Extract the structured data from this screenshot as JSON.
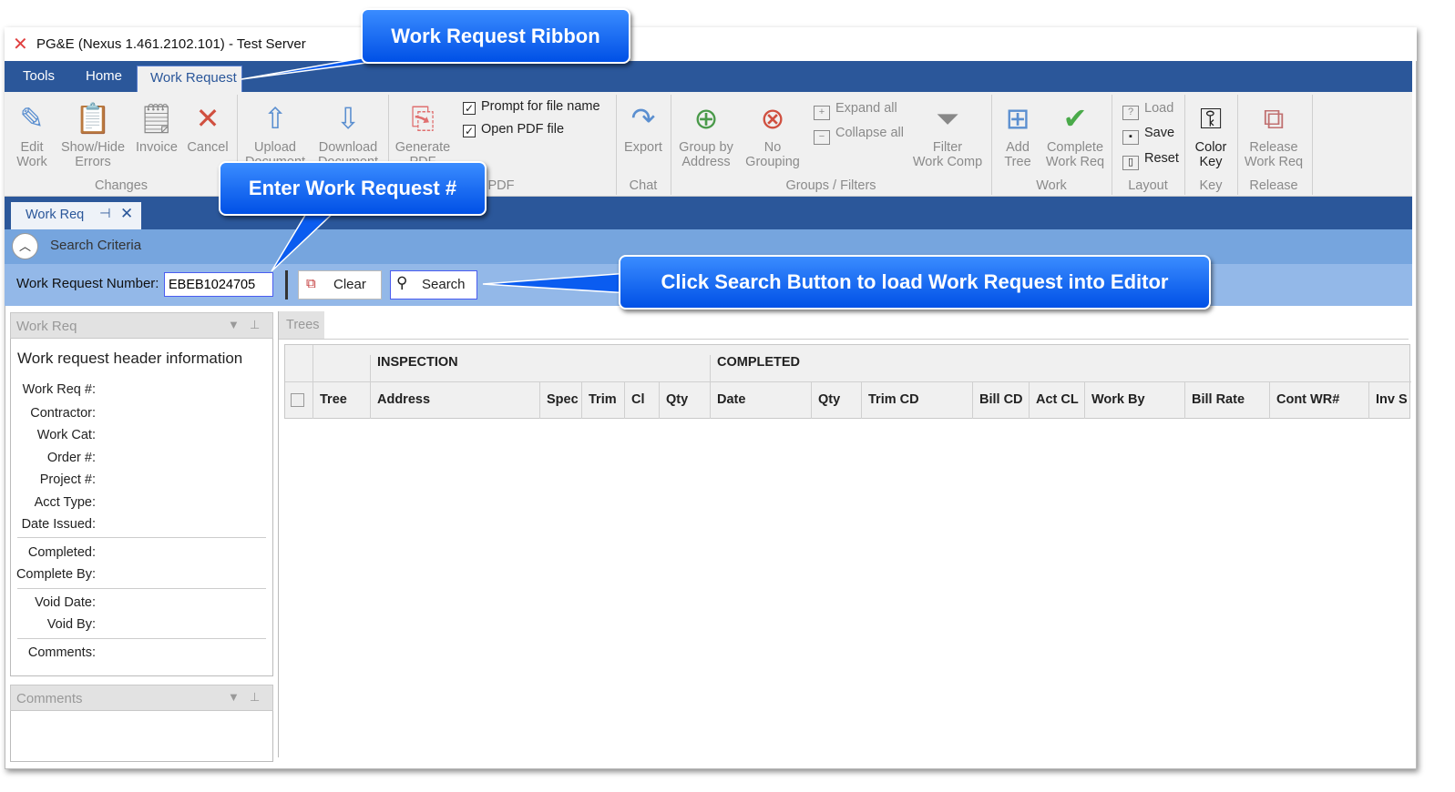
{
  "window": {
    "title": "PG&E (Nexus 1.461.2102.101) - Test Server"
  },
  "menu_tabs": [
    {
      "label": "Tools"
    },
    {
      "label": "Home"
    },
    {
      "label": "Work Request",
      "active": true
    }
  ],
  "ribbon": {
    "buttons": [
      {
        "label": [
          "Edit",
          "Work"
        ],
        "icon": "pencil-icon",
        "glyph": "✎",
        "color": "#5b8fd0",
        "enabled": false
      },
      {
        "label": [
          "Show/Hide",
          "Errors"
        ],
        "icon": "clipboard-error-icon",
        "glyph": "📋",
        "color": "#d08040",
        "enabled": false
      },
      {
        "label": [
          "Invoice",
          ""
        ],
        "icon": "document-list-icon",
        "glyph": "🗒",
        "color": "#888",
        "enabled": false
      },
      {
        "label": [
          "Cancel",
          ""
        ],
        "icon": "x-icon",
        "glyph": "✕",
        "color": "#d05040",
        "enabled": false
      },
      {
        "label": [
          "Upload",
          "Document"
        ],
        "icon": "upload-document-icon",
        "glyph": "⇧",
        "color": "#5b8fd0",
        "enabled": false
      },
      {
        "label": [
          "Download",
          "Document"
        ],
        "icon": "download-document-icon",
        "glyph": "⇩",
        "color": "#5b8fd0",
        "enabled": false
      },
      {
        "label": [
          "Generate",
          "PDF"
        ],
        "icon": "pdf-icon",
        "glyph": "⎘",
        "color": "#e07070",
        "enabled": false
      },
      {
        "label": [
          "Export",
          ""
        ],
        "icon": "export-icon",
        "glyph": "↷",
        "color": "#5b8fd0",
        "enabled": false
      },
      {
        "label": [
          "Group by",
          "Address"
        ],
        "icon": "group-add-icon",
        "glyph": "⊕",
        "color": "#4a9a4a",
        "enabled": false
      },
      {
        "label": [
          "No",
          "Grouping"
        ],
        "icon": "group-remove-icon",
        "glyph": "⊗",
        "color": "#d05040",
        "enabled": false
      },
      {
        "label": [
          "Filter",
          "Work Comp"
        ],
        "icon": "filter-icon",
        "glyph": "⏷",
        "color": "#888",
        "enabled": false
      },
      {
        "label": [
          "Add",
          "Tree"
        ],
        "icon": "add-tree-icon",
        "glyph": "⊞",
        "color": "#5b8fd0",
        "enabled": false
      },
      {
        "label": [
          "Complete",
          "Work Req"
        ],
        "icon": "clipboard-check-icon",
        "glyph": "✔",
        "color": "#4aaa4a",
        "enabled": false
      },
      {
        "label": [
          "Color",
          "Key"
        ],
        "icon": "key-icon",
        "glyph": "⚿",
        "color": "#222",
        "enabled": true
      },
      {
        "label": [
          "Release",
          "Work Req"
        ],
        "icon": "release-icon",
        "glyph": "⧉",
        "color": "#c07070",
        "enabled": false
      }
    ],
    "small_buttons": [
      {
        "label": "Expand all",
        "icon": "expand-icon",
        "glyph": "+",
        "enabled": false
      },
      {
        "label": "Collapse all",
        "icon": "collapse-icon",
        "glyph": "−",
        "enabled": false
      },
      {
        "label": "Load",
        "icon": "load-layout-icon",
        "glyph": "?",
        "enabled": false
      },
      {
        "label": "Save",
        "icon": "save-layout-icon",
        "glyph": "▪",
        "enabled": true
      },
      {
        "label": "Reset",
        "icon": "reset-layout-icon",
        "glyph": "▯",
        "enabled": true
      }
    ],
    "checkboxes": [
      {
        "label": "Prompt for file name",
        "checked": true
      },
      {
        "label": "Open PDF file",
        "checked": true
      }
    ],
    "groups": [
      "Changes",
      "PDF",
      "Chat",
      "Groups / Filters",
      "Work",
      "Layout",
      "Key",
      "Release"
    ]
  },
  "doc_tab": {
    "label": "Work Req"
  },
  "search": {
    "criteria_label": "Search Criteria",
    "wr_label": "Work Request Number:",
    "wr_value": "EBEB1024705",
    "clear_label": "Clear",
    "search_label": "Search"
  },
  "left_panel": {
    "title": "Work Req",
    "header": "Work request header information",
    "fields": [
      "Work Req #:",
      "Contractor:",
      "Work Cat:",
      "Order #:",
      "Project #:",
      "Acct Type:",
      "Date Issued:",
      "Completed:",
      "Complete By:",
      "Void Date:",
      "Void By:",
      "Comments:"
    ],
    "comments_title": "Comments"
  },
  "trees": {
    "tab_label": "Trees",
    "groups": [
      "INSPECTION",
      "COMPLETED"
    ],
    "columns": [
      "Tree",
      "Address",
      "Spec",
      "Trim",
      "Cl",
      "Qty",
      "Date",
      "Qty",
      "Trim CD",
      "Bill CD",
      "Act CL",
      "Work By",
      "Bill Rate",
      "Cont WR#",
      "Inv S"
    ]
  },
  "callouts": {
    "ribbon": "Work Request Ribbon",
    "enter": "Enter Work Request #",
    "search": "Click Search Button to load Work Request into Editor"
  },
  "colors": {
    "ribbon_blue": "#2b579a",
    "criteria_blue": "#76a5de",
    "callout_blue": "#0a5cf0"
  }
}
